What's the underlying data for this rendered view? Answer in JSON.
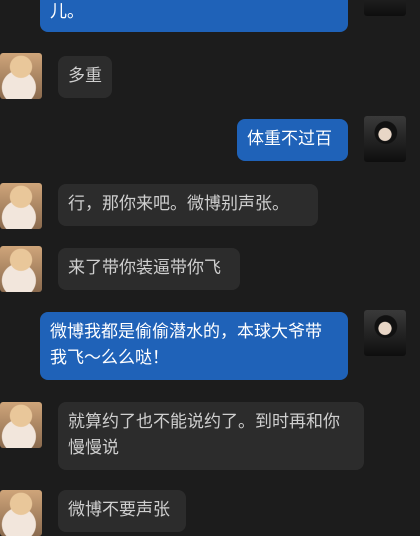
{
  "messages": [
    {
      "side": "right",
      "text": "儿。"
    },
    {
      "side": "left",
      "text": "多重"
    },
    {
      "side": "right",
      "text": "体重不过百"
    },
    {
      "side": "left",
      "text": "行，那你来吧。微博别声张。"
    },
    {
      "side": "left",
      "text": "来了带你装逼带你飞"
    },
    {
      "side": "right",
      "text": "微博我都是偷偷潜水的，本球大爷带我飞～么么哒！"
    },
    {
      "side": "left",
      "text": "就算约了也不能说约了。到时再和你慢慢说"
    },
    {
      "side": "left",
      "text": "微博不要声张"
    }
  ]
}
